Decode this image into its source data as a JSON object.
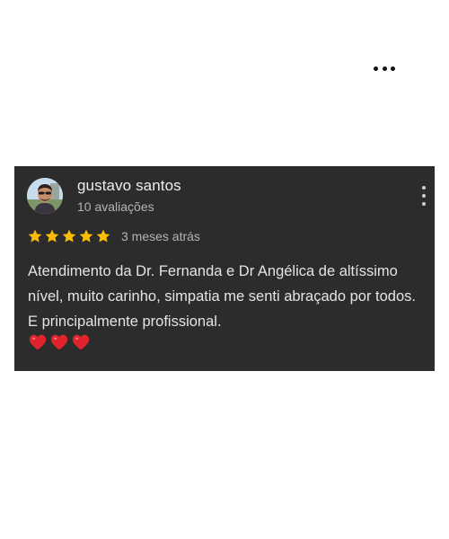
{
  "review": {
    "author_name": "gustavo santos",
    "review_count": "10 avaliações",
    "rating": 5,
    "rating_max": 5,
    "date": "3 meses atrás",
    "text": "Atendimento da Dr. Fernanda e Dr Angélica de altíssimo nível, muito carinho, simpatia me senti abraçado por todos. E principalmente profissional.",
    "emoji": "❤️❤️❤️"
  },
  "icons": {
    "top_more": "more-horizontal-icon",
    "card_more": "more-vertical-icon",
    "star": "star-icon",
    "heart": "heart-icon"
  },
  "colors": {
    "card_background": "#2c2c2c",
    "star": "#fbbc04",
    "heart": "#e0242e",
    "page_background": "#ffffff"
  }
}
